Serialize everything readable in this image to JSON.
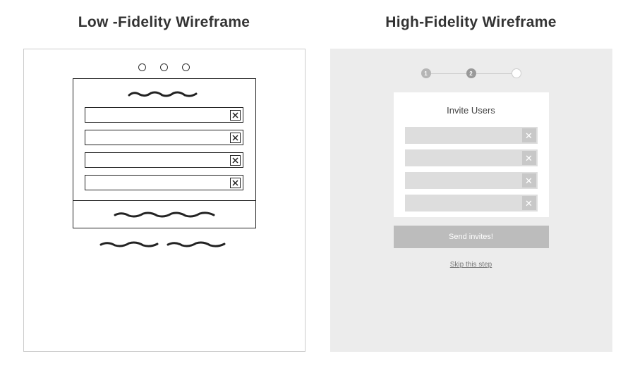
{
  "left": {
    "title": "Low -Fidelity Wireframe"
  },
  "right": {
    "title": "High-Fidelity Wireframe",
    "stepper": {
      "step1_num": "1",
      "step2_num": "2"
    },
    "card": {
      "title": "Invite Users",
      "button_label": "Send invites!",
      "skip_label": "Skip this step"
    }
  }
}
